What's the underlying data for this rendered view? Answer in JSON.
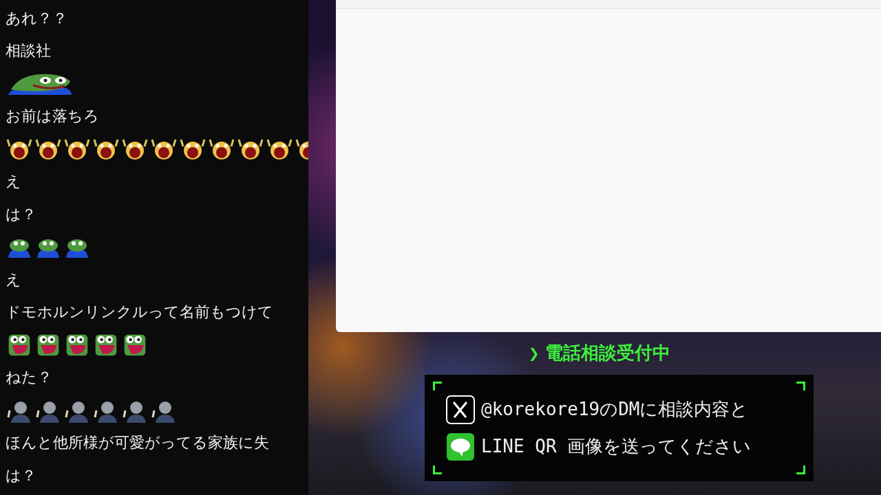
{
  "chat": {
    "messages": [
      {
        "kind": "text",
        "text": "あれ？？"
      },
      {
        "kind": "text",
        "text": "相談社"
      },
      {
        "kind": "emotes",
        "emotes": [
          {
            "kind": "grin"
          }
        ]
      },
      {
        "kind": "text",
        "text": "お前は落ちろ"
      },
      {
        "kind": "emotes",
        "emotes": [
          {
            "kind": "scream"
          },
          {
            "kind": "scream"
          },
          {
            "kind": "scream"
          },
          {
            "kind": "scream"
          },
          {
            "kind": "scream"
          },
          {
            "kind": "scream"
          },
          {
            "kind": "scream"
          },
          {
            "kind": "scream"
          },
          {
            "kind": "scream"
          },
          {
            "kind": "scream"
          },
          {
            "kind": "scream"
          }
        ]
      },
      {
        "kind": "text",
        "text": "え"
      },
      {
        "kind": "text",
        "text": "は？"
      },
      {
        "kind": "emotes",
        "emotes": [
          {
            "kind": "frog"
          },
          {
            "kind": "frog"
          },
          {
            "kind": "frog"
          }
        ]
      },
      {
        "kind": "text",
        "text": "え"
      },
      {
        "kind": "text",
        "text": "ドモホルンリンクルって名前もつけて"
      },
      {
        "kind": "emotes",
        "emotes": [
          {
            "kind": "shout"
          },
          {
            "kind": "shout"
          },
          {
            "kind": "shout"
          },
          {
            "kind": "shout"
          },
          {
            "kind": "shout"
          }
        ]
      },
      {
        "kind": "text",
        "text": "ねた？"
      },
      {
        "kind": "emotes",
        "emotes": [
          {
            "kind": "person"
          },
          {
            "kind": "person"
          },
          {
            "kind": "person"
          },
          {
            "kind": "person"
          },
          {
            "kind": "person"
          },
          {
            "kind": "person"
          }
        ]
      },
      {
        "kind": "text",
        "text": "ほんと他所様が可愛がってる家族に失"
      },
      {
        "kind": "text",
        "text": "は？"
      }
    ]
  },
  "overlay": {
    "heading": {
      "arrow": "❯",
      "text": "電話相談受付中"
    },
    "lines": [
      {
        "kind": "x",
        "text": "@korekore19のDMに相談内容と"
      },
      {
        "kind": "line",
        "text": "LINE QR 画像を送ってください"
      }
    ]
  }
}
